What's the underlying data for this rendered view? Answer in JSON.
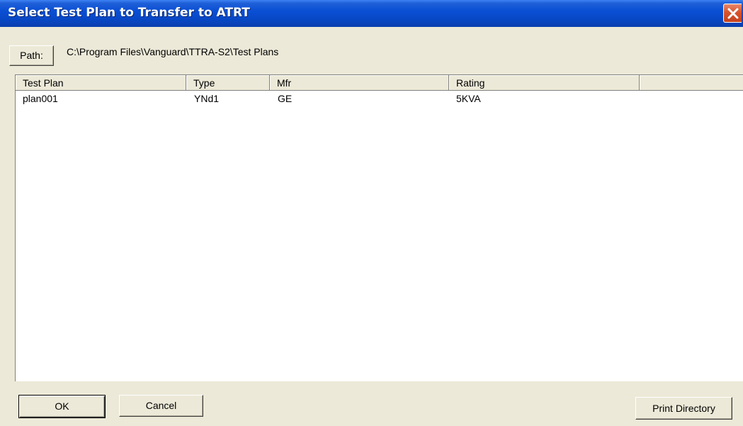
{
  "window": {
    "title": "Select Test Plan to Transfer to ATRT",
    "close_icon": "close-icon"
  },
  "path": {
    "button_label": "Path:",
    "value": "C:\\Program Files\\Vanguard\\TTRA-S2\\Test Plans"
  },
  "list": {
    "columns": [
      "Test Plan",
      "Type",
      "Mfr",
      "Rating",
      ""
    ],
    "rows": [
      [
        "plan001",
        "YNd1",
        "GE",
        "5KVA"
      ]
    ]
  },
  "buttons": {
    "ok": "OK",
    "cancel": "Cancel",
    "print_directory": "Print Directory"
  },
  "colors": {
    "titlebar": "#0a4fd4",
    "face": "#ece9d8",
    "close": "#d6542f"
  }
}
